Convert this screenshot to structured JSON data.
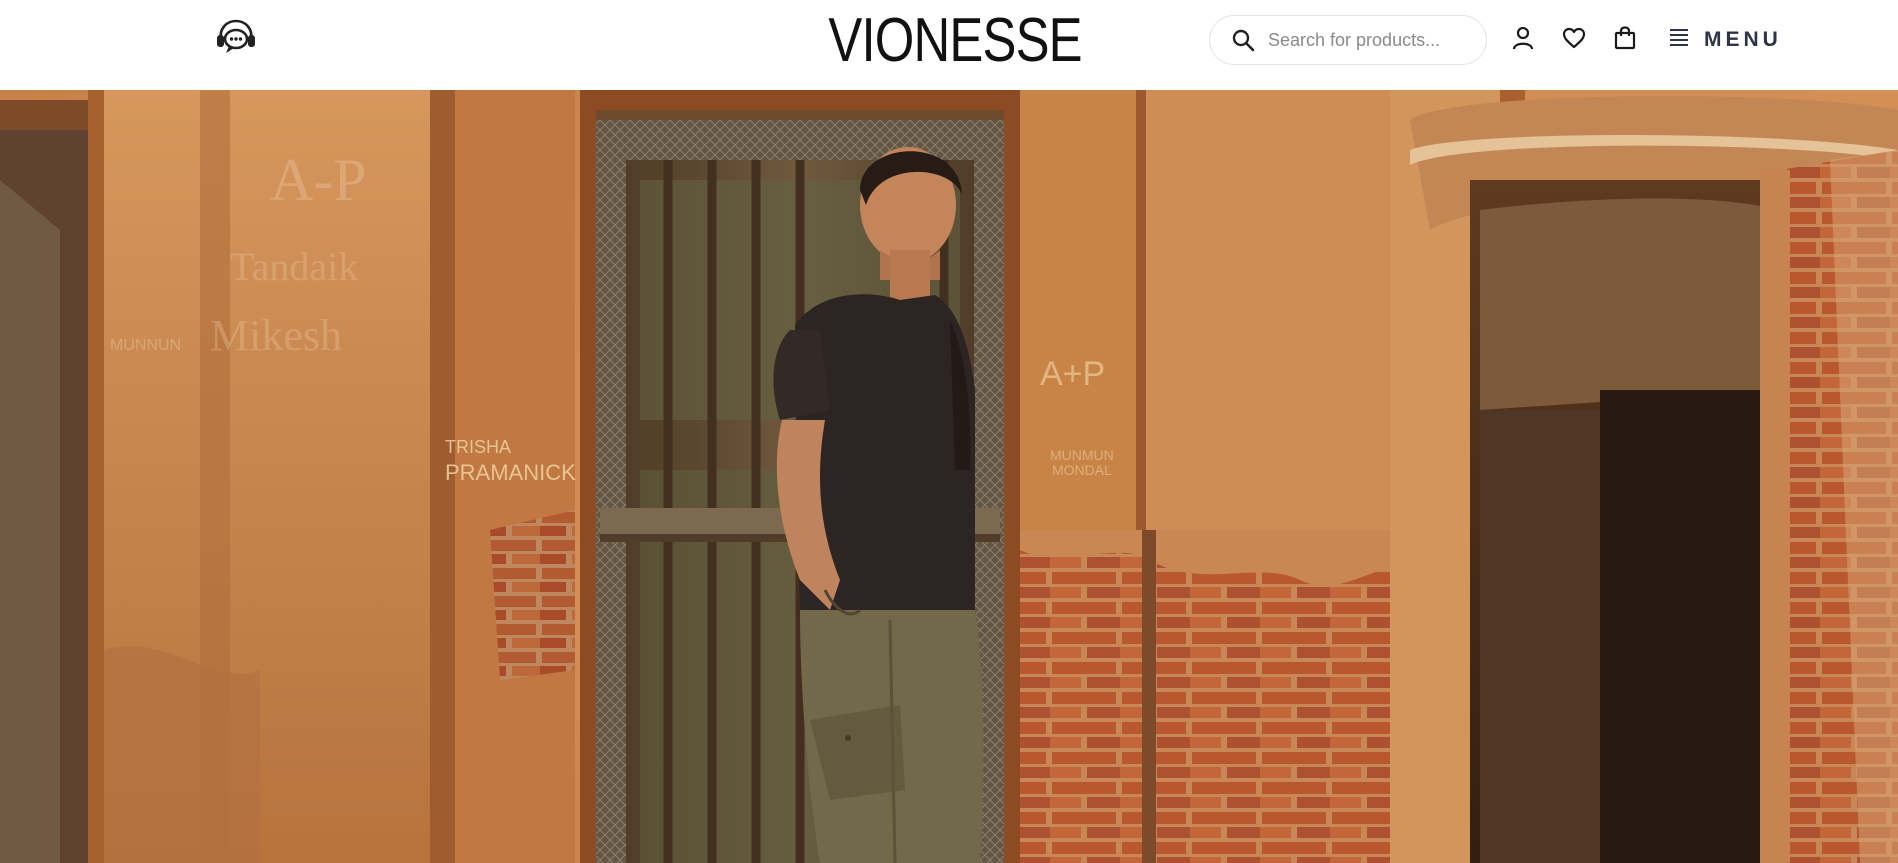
{
  "header": {
    "brand": "VIONESSE",
    "support_icon": "headset-chat-icon",
    "search": {
      "icon": "search-icon",
      "placeholder": "Search for products..."
    },
    "icons": {
      "account": "user-icon",
      "wishlist": "heart-icon",
      "cart": "shopping-bag-icon",
      "menu": "menu-lines-icon"
    },
    "menu_label": "MENU"
  },
  "hero": {
    "image_alt": "Man in black t-shirt and olive cargo pants standing in front of a weathered orange wall with a wooden door",
    "graffiti": {
      "left": "TRISHA\nPRAMANICK",
      "center": "A+P"
    }
  },
  "colors": {
    "wall": "#c87f45",
    "wall_dark": "#8a4a22",
    "door": "#5c4a35",
    "shirt": "#252122",
    "pants": "#6e6a4c",
    "brick": "#b3542c"
  }
}
